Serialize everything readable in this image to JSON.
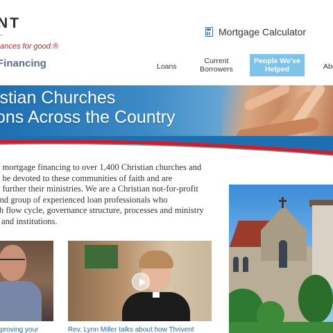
{
  "header": {
    "logo_text": "NT",
    "logo_sub": "L",
    "tagline": "nances for good.®",
    "section_title": "Financing"
  },
  "utility": {
    "calculator_label": "Mortgage Calculator",
    "calculator_icon": "calculator-icon"
  },
  "nav": {
    "items": [
      {
        "label": "Loans"
      },
      {
        "label": "Current Borrowers"
      },
      {
        "label": "People We've Helped",
        "active": true
      },
      {
        "label": "Abo"
      }
    ]
  },
  "banner": {
    "line1": "istian Churches",
    "line2": "ons Across the Country"
  },
  "intro": {
    "lines": [
      "g mortgage financing to over 1,400 Christian churches and",
      "o be devoted to these communities of faith and are",
      "n further their ministries. We are a Christian not-for-profit",
      "and group of experienced loan professionals who",
      "sh flow cycle, governance structure, processes and ministry",
      "s and institutions."
    ]
  },
  "videos": [
    {
      "caption": "mproving your"
    },
    {
      "caption": "Rev. Lynn Miller talks about how Thrivent"
    }
  ],
  "colors": {
    "accent_red": "#b8242e",
    "nav_active_bg": "#7ec3ea",
    "link_blue": "#2a66a8",
    "banner_blue": "#1d6fb2"
  }
}
